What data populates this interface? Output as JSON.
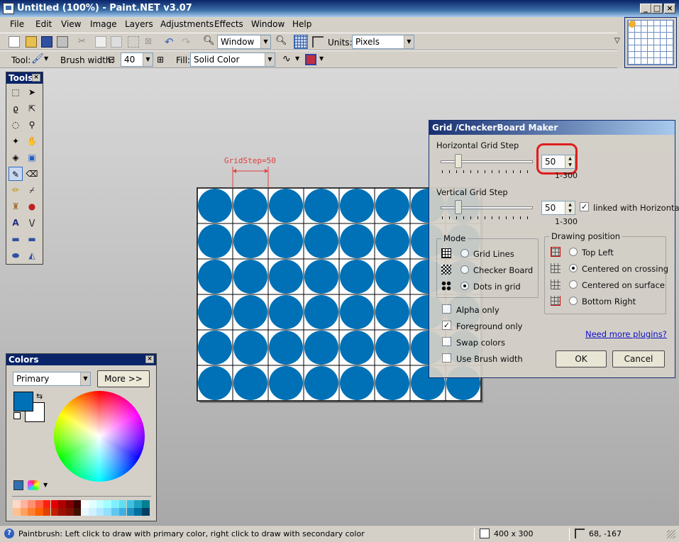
{
  "app": {
    "title": "Untitled (100%) - Paint.NET v3.07",
    "min": "_",
    "max": "□",
    "close": "×"
  },
  "menu": [
    "File",
    "Edit",
    "View",
    "Image",
    "Layers",
    "Adjustments",
    "Effects",
    "Window",
    "Help"
  ],
  "toolbar1": {
    "zoom_value": "Window",
    "units_label": "Units:",
    "units_value": "Pixels"
  },
  "toolbar2": {
    "tool_label": "Tool:",
    "brush_label": "Brush width:",
    "brush_value": "40",
    "fill_label": "Fill:",
    "fill_value": "Solid Color",
    "minus": "⊟",
    "plus": "⊞"
  },
  "tools_panel": {
    "title": "Tools"
  },
  "canvas": {
    "annotation": "GridStep=50",
    "rows": 6,
    "cols": 8,
    "dot_color": "#0071b6"
  },
  "colors_panel": {
    "title": "Colors",
    "mode": "Primary",
    "more_button": "More >>",
    "primary": "#0071b6",
    "secondary": "#ffffff",
    "palette_top": [
      "#ffd8c8",
      "#ffb4a0",
      "#ff9070",
      "#ff6040",
      "#ff2010",
      "#e00000",
      "#b00000",
      "#800000",
      "#400000",
      "#ffffff",
      "#e0ffff",
      "#c0ffff",
      "#a0ffff",
      "#80f0ff",
      "#60e0f0",
      "#40c0e0",
      "#20a0c0",
      "#008090"
    ],
    "palette_bottom": [
      "#ffc090",
      "#ffa060",
      "#ff8030",
      "#ff6000",
      "#e04000",
      "#c02000",
      "#a01000",
      "#801000",
      "#401000",
      "#e8f8ff",
      "#d0f0ff",
      "#b0e8ff",
      "#90e0ff",
      "#60c8f0",
      "#40b0e0",
      "#2090c0",
      "#0070a0",
      "#004060"
    ]
  },
  "dialog": {
    "title": "Grid /CheckerBoard Maker",
    "h_step_label": "Horizontal Grid Step",
    "h_step_value": "50",
    "h_range": "1-300",
    "v_step_label": "Vertical Grid Step",
    "v_step_value": "50",
    "v_range": "1-300",
    "linked_label": "linked with Horizontal",
    "mode_label": "Mode",
    "modes": [
      "Grid Lines",
      "Checker Board",
      "Dots in grid"
    ],
    "position_label": "Drawing position",
    "positions": [
      "Top Left",
      "Centered on crossing",
      "Centered on surface",
      "Bottom Right"
    ],
    "checks": [
      "Alpha only",
      "Foreground only",
      "Swap colors",
      "Use Brush width"
    ],
    "plugins_link": "Need more plugins?",
    "ok": "OK",
    "cancel": "Cancel",
    "highlight_color": "#e01010"
  },
  "status": {
    "text": "Paintbrush: Left click to draw with primary color, right click to draw with secondary color",
    "size": "400 x 300",
    "coords": "68, -167"
  }
}
